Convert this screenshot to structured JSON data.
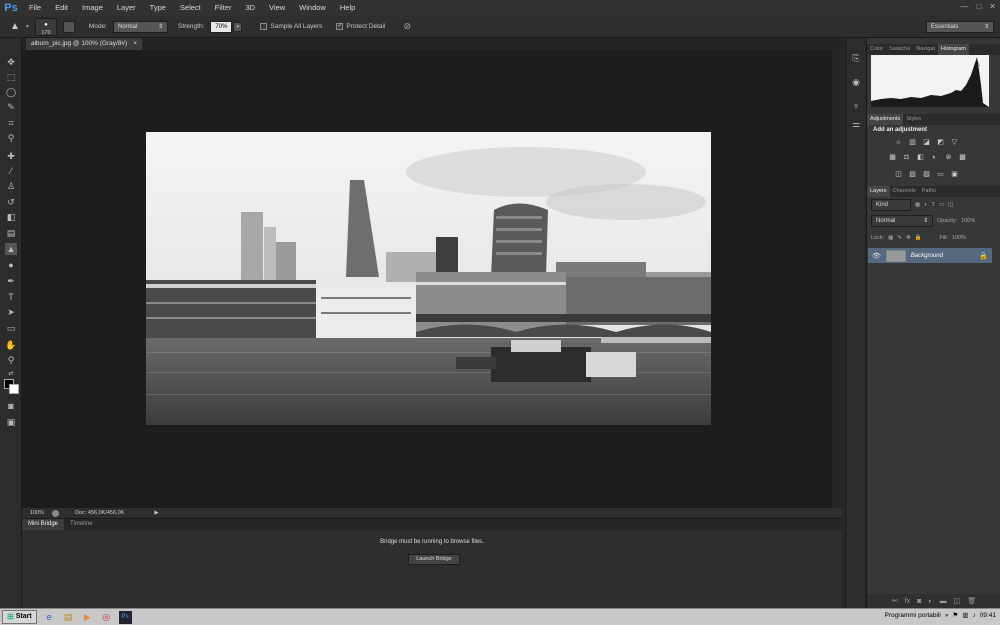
{
  "app": {
    "logo": "Ps",
    "menu": [
      "File",
      "Edit",
      "Image",
      "Layer",
      "Type",
      "Select",
      "Filter",
      "3D",
      "View",
      "Window",
      "Help"
    ],
    "window_controls": [
      "—",
      "□",
      "✕"
    ]
  },
  "options_bar": {
    "brush_size": "170",
    "mode_label": "Mode:",
    "mode_value": "Normal",
    "strength_label": "Strength:",
    "strength_value": "70%",
    "sample_all_layers": "Sample All Layers",
    "protect_detail": "Protect Detail",
    "workspace": "Essentials"
  },
  "document": {
    "tab_title": "album_pic.jpg @ 100% (Gray/8#)",
    "tab_close": "×",
    "zoom": "100%",
    "doc_info": "Doc: 456,0K/456,0K"
  },
  "mini_bridge": {
    "tabs": [
      "Mini Bridge",
      "Timeline"
    ],
    "message": "Bridge must be running to browse files.",
    "button": "Launch Bridge"
  },
  "panels": {
    "top_tabs": [
      "Color",
      "Swatche",
      "Navigat",
      "Histogram"
    ],
    "adjust_tabs": [
      "Adjustments",
      "Styles"
    ],
    "add_adjustment": "Add an adjustment",
    "layer_tabs": [
      "Layers",
      "Channels",
      "Paths"
    ],
    "kind": "Kind",
    "blend_mode": "Normal",
    "opacity_label": "Opacity:",
    "opacity_value": "100%",
    "lock_label": "Lock:",
    "fill_label": "Fill:",
    "fill_value": "100%",
    "layer_name": "Background"
  },
  "taskbar": {
    "start": "Start",
    "tray_label": "Programmi portabili",
    "clock": "09:41"
  },
  "colors": {
    "accent": "#4a9ae8",
    "panel_bg": "#373737",
    "canvas_bg": "#1d1d1d",
    "selected_layer": "#54687f"
  }
}
